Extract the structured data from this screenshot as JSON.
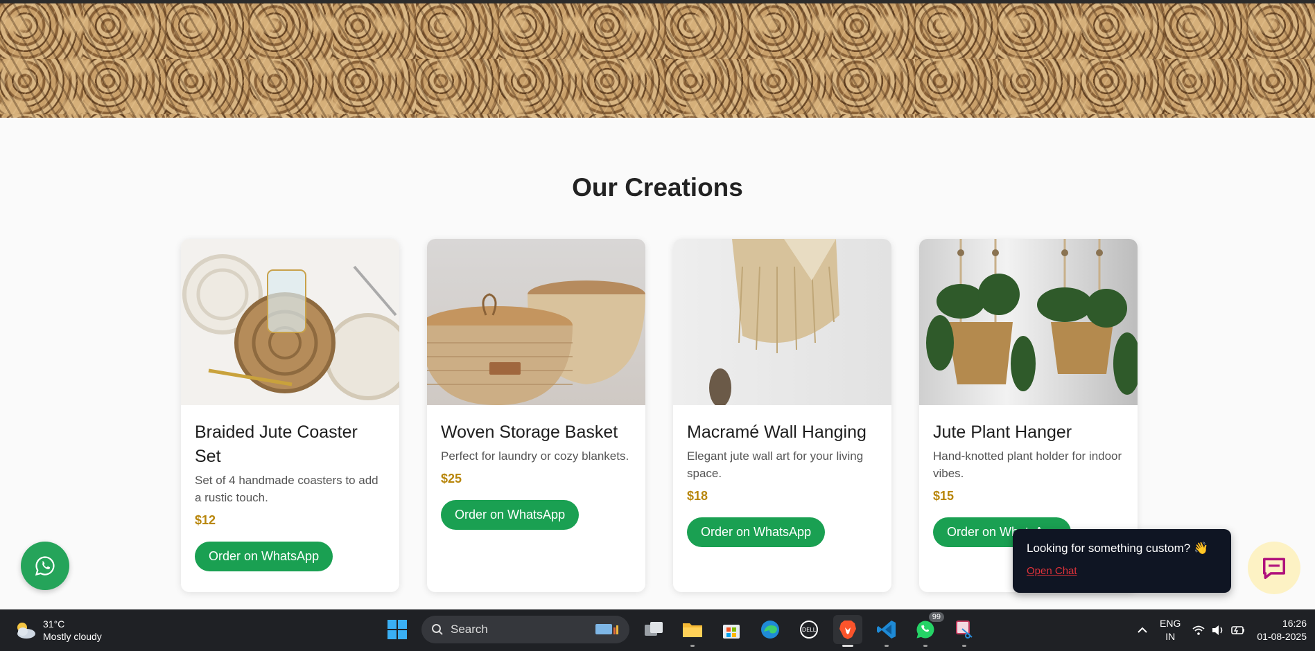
{
  "section": {
    "title": "Our Creations"
  },
  "products": [
    {
      "title": "Braided Jute Coaster Set",
      "desc": "Set of 4 handmade coasters to add a rustic touch.",
      "price": "$12",
      "button": "Order on WhatsApp"
    },
    {
      "title": "Woven Storage Basket",
      "desc": "Perfect for laundry or cozy blankets.",
      "price": "$25",
      "button": "Order on WhatsApp"
    },
    {
      "title": "Macramé Wall Hanging",
      "desc": "Elegant jute wall art for your living space.",
      "price": "$18",
      "button": "Order on WhatsApp"
    },
    {
      "title": "Jute Plant Hanger",
      "desc": "Hand-knotted plant holder for indoor vibes.",
      "price": "$15",
      "button": "Order on WhatsApp"
    }
  ],
  "chat": {
    "message": "Looking for something custom? 👋",
    "link": "Open Chat"
  },
  "taskbar": {
    "weather_temp": "31°C",
    "weather_desc": "Mostly cloudy",
    "search_label": "Search",
    "whatsapp_badge": "99",
    "lang_top": "ENG",
    "lang_bottom": "IN",
    "time": "16:26",
    "date": "01-08-2025"
  },
  "colors": {
    "accent_green": "#1aa052",
    "price_gold": "#b8860b",
    "chat_bg": "#0f1523"
  }
}
